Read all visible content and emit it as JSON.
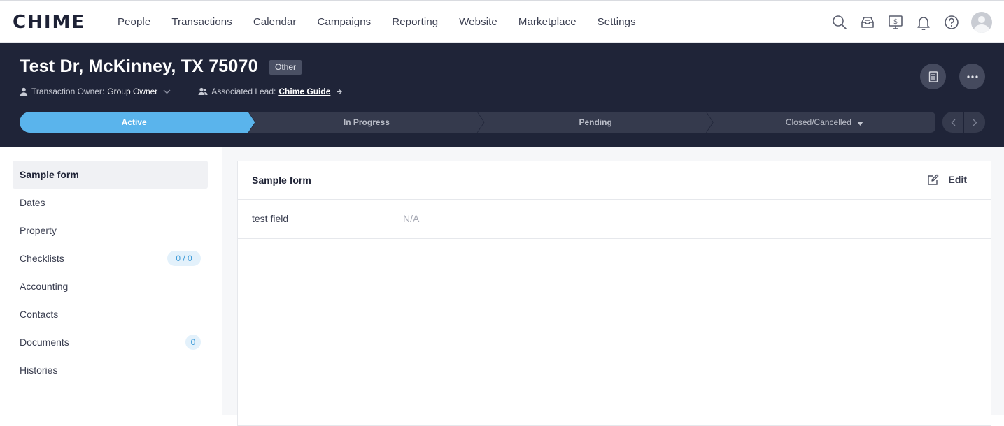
{
  "app": {
    "logo_text": "CHIME"
  },
  "nav": {
    "items": [
      "People",
      "Transactions",
      "Calendar",
      "Campaigns",
      "Reporting",
      "Website",
      "Marketplace",
      "Settings"
    ],
    "icons": [
      "search-icon",
      "inbox-icon",
      "dollar-monitor-icon",
      "bell-icon",
      "help-icon",
      "avatar"
    ]
  },
  "header": {
    "title": "Test Dr, McKinney, TX 75070",
    "type_badge": "Other",
    "owner_label": "Transaction Owner:",
    "owner_value": "Group Owner",
    "lead_label": "Associated Lead:",
    "lead_value": "Chime Guide"
  },
  "stages": {
    "items": [
      {
        "label": "Active",
        "state": "current"
      },
      {
        "label": "In Progress",
        "state": "upcoming"
      },
      {
        "label": "Pending",
        "state": "upcoming"
      },
      {
        "label": "Closed/Cancelled",
        "state": "upcoming"
      }
    ],
    "colors": {
      "current": "#5ab4ec",
      "upcoming": "#353a4d",
      "upcoming_text": "#b9bcc7"
    }
  },
  "sidebar": {
    "items": [
      {
        "label": "Sample form",
        "active": true,
        "count": ""
      },
      {
        "label": "Dates",
        "count": ""
      },
      {
        "label": "Property",
        "count": ""
      },
      {
        "label": "Checklists",
        "count": "0 / 0"
      },
      {
        "label": "Accounting",
        "count": ""
      },
      {
        "label": "Contacts",
        "count": ""
      },
      {
        "label": "Documents",
        "count": "0"
      },
      {
        "label": "Histories",
        "count": ""
      }
    ]
  },
  "main": {
    "card_title": "Sample form",
    "edit_label": "Edit",
    "fields": [
      {
        "label": "test field",
        "value": "N/A"
      }
    ]
  }
}
